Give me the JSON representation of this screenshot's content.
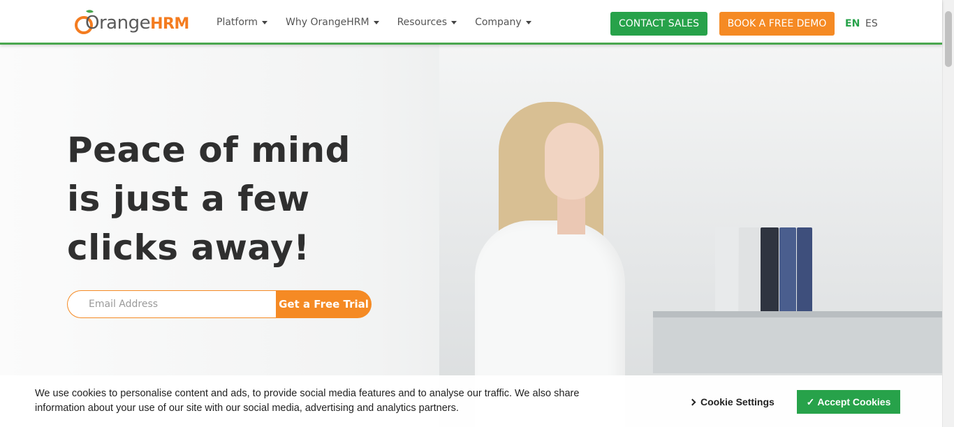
{
  "header": {
    "logo": {
      "brand_main": "Orange",
      "brand_suffix": "HRM",
      "accent": "#f47c20",
      "leaf": "#4aa74f"
    },
    "nav": [
      {
        "label": "Platform"
      },
      {
        "label": "Why OrangeHRM"
      },
      {
        "label": "Resources"
      },
      {
        "label": "Company"
      }
    ],
    "contact_sales": "CONTACT SALES",
    "book_demo": "BOOK A FREE DEMO",
    "lang_en": "EN",
    "lang_es": "ES",
    "colors": {
      "green": "#27a24a",
      "orange": "#f58a24"
    }
  },
  "hero": {
    "headline": [
      "Peace of mind",
      "is just a few",
      "clicks away!"
    ],
    "email_placeholder": "Email Address",
    "trial_button": "Get a Free Trial"
  },
  "cookie": {
    "text": "We use cookies to personalise content and ads, to provide social media features and to analyse our traffic. We also share information about your use of our site with our social media, advertising and analytics partners.",
    "settings": "Cookie Settings",
    "accept": "Accept Cookies"
  }
}
